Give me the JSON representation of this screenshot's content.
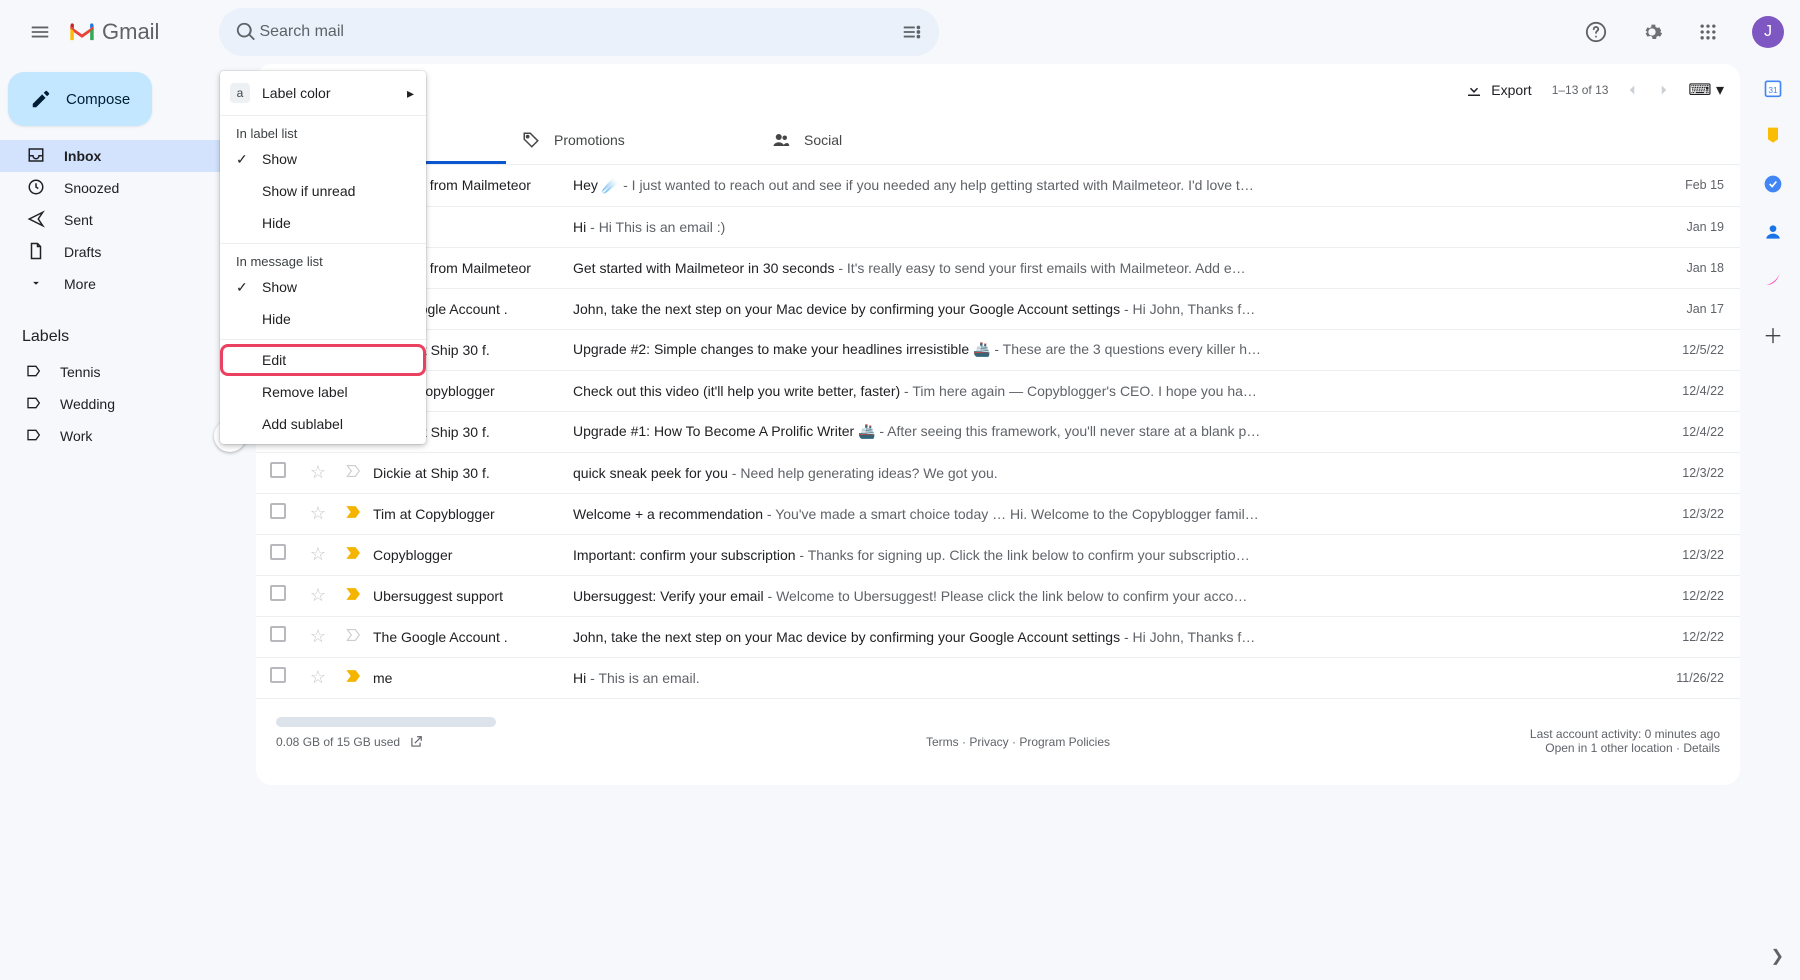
{
  "app": {
    "name": "Gmail"
  },
  "header": {
    "search_placeholder": "Search mail",
    "avatar_letter": "J"
  },
  "compose_label": "Compose",
  "nav": {
    "inbox": "Inbox",
    "snoozed": "Snoozed",
    "sent": "Sent",
    "drafts": "Drafts",
    "more": "More"
  },
  "labels_section": {
    "title": "Labels",
    "items": [
      "Tennis",
      "Wedding",
      "Work"
    ]
  },
  "context_menu": {
    "swatch_letter": "a",
    "label_color": "Label color",
    "in_label_list": "In label list",
    "show": "Show",
    "show_if_unread": "Show if unread",
    "hide": "Hide",
    "in_message_list": "In message list",
    "edit": "Edit",
    "remove_label": "Remove label",
    "add_sublabel": "Add sublabel"
  },
  "toolbar": {
    "export": "Export",
    "range": "1–13 of 13"
  },
  "tabs": {
    "promotions": "Promotions",
    "social": "Social"
  },
  "emails": [
    {
      "imp": "y",
      "sender": "Corentin from Mailmeteor",
      "subject": "Hey ☄️",
      "snippet": "I just wanted to reach out and see if you needed any help getting started with Mailmeteor. I'd love t…",
      "date": "Feb 15"
    },
    {
      "imp": "y",
      "sender": "",
      "subject": "Hi",
      "snippet": "Hi This is an email :)",
      "date": "Jan 19"
    },
    {
      "imp": "y",
      "sender": "Corentin from Mailmeteor",
      "subject": "Get started with Mailmeteor in 30 seconds",
      "snippet": "It's really easy to send your first emails with Mailmeteor. Add e…",
      "date": "Jan 18"
    },
    {
      "imp": "g",
      "sender": "The Google Account .",
      "subject": "John, take the next step on your Mac device by confirming your Google Account settings",
      "snippet": "Hi John, Thanks f…",
      "date": "Jan 17"
    },
    {
      "imp": "g",
      "sender": "Dickie at Ship 30 f.",
      "subject": "Upgrade #2: Simple changes to make your headlines irresistible 🚢",
      "snippet": "These are the 3 questions every killer h…",
      "date": "12/5/22"
    },
    {
      "imp": "g",
      "sender": "Tim at Copyblogger",
      "subject": "Check out this video (it'll help you write better, faster)",
      "snippet": "Tim here again — Copyblogger's CEO. I hope you ha…",
      "date": "12/4/22"
    },
    {
      "imp": "g",
      "sender": "Dickie at Ship 30 f.",
      "subject": "Upgrade #1: How To Become A Prolific Writer 🚢",
      "snippet": "After seeing this framework, you'll never stare at a blank p…",
      "date": "12/4/22"
    },
    {
      "imp": "g",
      "sender": "Dickie at Ship 30 f.",
      "subject": "quick sneak peek for you",
      "snippet": "Need help generating ideas? We got you.",
      "date": "12/3/22"
    },
    {
      "imp": "y",
      "sender": "Tim at Copyblogger",
      "subject": "Welcome + a recommendation",
      "snippet": "You've made a smart choice today … Hi. Welcome to the Copyblogger famil…",
      "date": "12/3/22"
    },
    {
      "imp": "y",
      "sender": "Copyblogger",
      "subject": "Important: confirm your subscription",
      "snippet": "Thanks for signing up. Click the link below to confirm your subscriptio…",
      "date": "12/3/22"
    },
    {
      "imp": "y",
      "sender": "Ubersuggest support",
      "subject": "Ubersuggest: Verify your email",
      "snippet": "Welcome to Ubersuggest! Please click the link below to confirm your acco…",
      "date": "12/2/22"
    },
    {
      "imp": "g",
      "sender": "The Google Account .",
      "subject": "John, take the next step on your Mac device by confirming your Google Account settings",
      "snippet": "Hi John, Thanks f…",
      "date": "12/2/22"
    },
    {
      "imp": "y",
      "sender": "me",
      "subject": "Hi",
      "snippet": "This is an email.",
      "date": "11/26/22"
    }
  ],
  "footer": {
    "storage": "0.08 GB of 15 GB used",
    "terms": "Terms",
    "privacy": "Privacy",
    "policies": "Program Policies",
    "activity": "Last account activity: 0 minutes ago",
    "open_in": "Open in 1 other location · Details"
  }
}
